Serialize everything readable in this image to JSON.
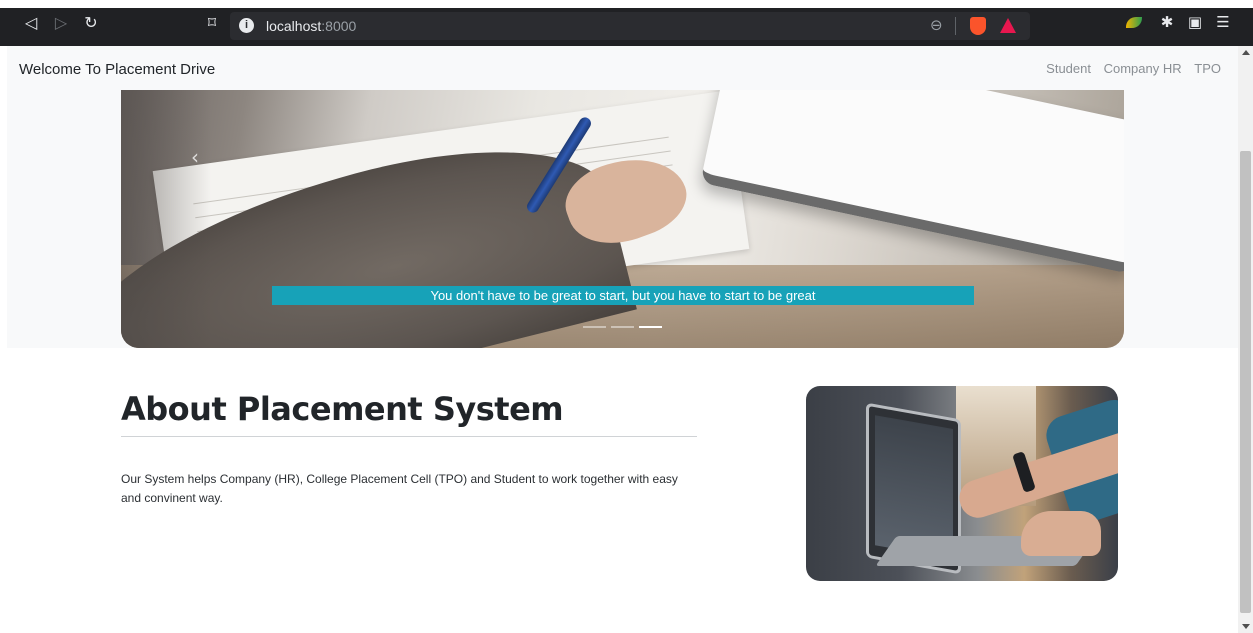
{
  "browser": {
    "url_host": "localhost",
    "url_port": ":8000",
    "icons": {
      "back": "back-icon",
      "forward": "forward-icon",
      "reload": "reload-icon",
      "bookmark": "bookmark-icon",
      "site_info": "info-icon",
      "zoom": "zoom-icon",
      "brave_shields": "brave-shield-icon",
      "brave_rewards": "brave-rewards-icon",
      "extension": "extension-icon",
      "puzzle": "puzzle-icon",
      "wallet": "wallet-icon",
      "menu": "menu-icon"
    }
  },
  "navbar": {
    "brand": "Welcome To Placement Drive",
    "links": [
      "Student",
      "Company HR",
      "TPO"
    ]
  },
  "carousel": {
    "caption": "You don't have to be great to start, but you have to start to be great",
    "slide_count": 3,
    "active_slide": 3,
    "caption_color": "#17a2b8"
  },
  "about": {
    "title": "About Placement System",
    "text": "Our System helps Company (HR), College Placement Cell (TPO) and Student to work together with easy and convinent way."
  }
}
